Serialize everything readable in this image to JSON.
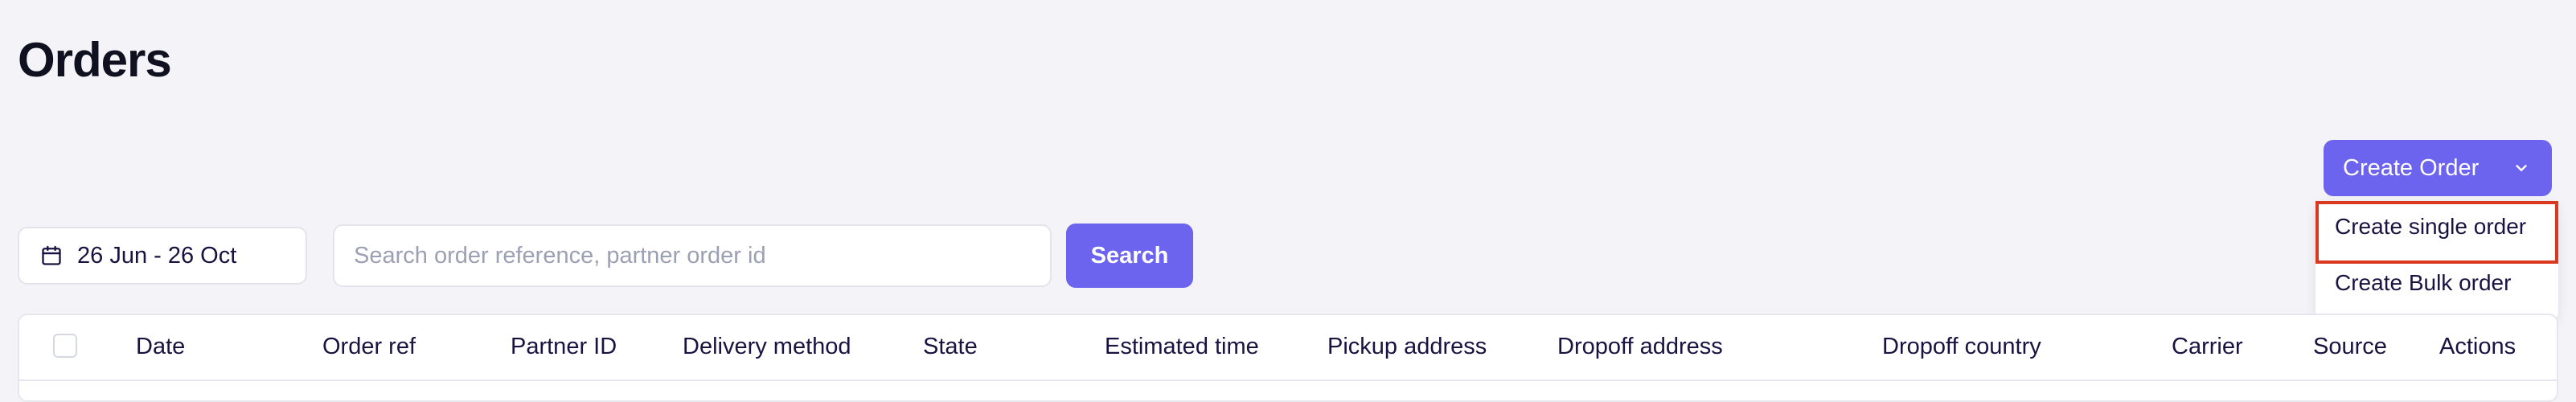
{
  "page": {
    "title": "Orders"
  },
  "create_order": {
    "label": "Create Order",
    "icon": "chevron-down-icon",
    "menu": [
      {
        "label": "Create single order",
        "highlighted": true
      },
      {
        "label": "Create Bulk order",
        "highlighted": false
      }
    ]
  },
  "filters": {
    "date_range": {
      "icon": "calendar-icon",
      "value": "26 Jun - 26 Oct"
    },
    "search": {
      "placeholder": "Search order reference, partner order id",
      "value": "",
      "button_label": "Search"
    }
  },
  "table": {
    "columns": [
      "Date",
      "Order ref",
      "Partner ID",
      "Delivery method",
      "State",
      "Estimated time",
      "Pickup address",
      "Dropoff address",
      "Dropoff country",
      "Carrier",
      "Source",
      "Actions"
    ]
  },
  "colors": {
    "accent": "#6c63ef",
    "background": "#f4f4f8",
    "highlight_border": "#d9391f",
    "text": "#1a1240"
  }
}
